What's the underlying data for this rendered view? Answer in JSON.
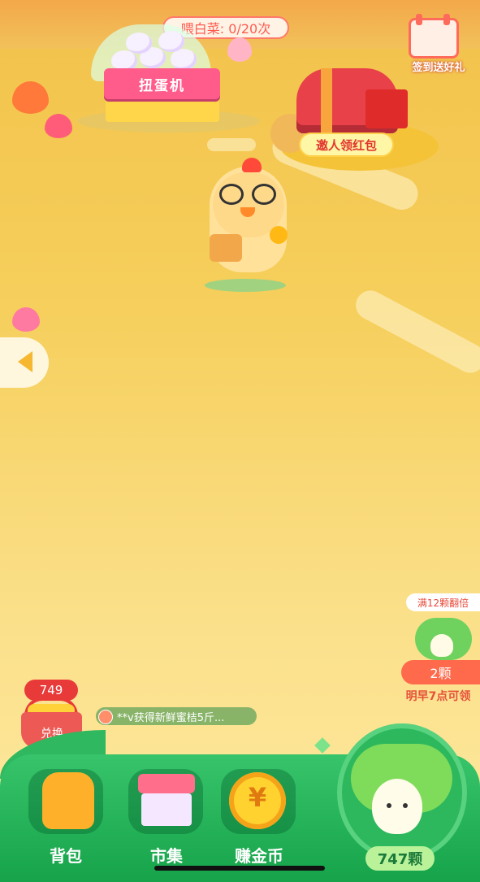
{
  "feed": {
    "label": "喂白菜: 0/20次"
  },
  "gacha": {
    "sign": "扭蛋机"
  },
  "signin": {
    "label": "签到送好礼"
  },
  "invite": {
    "label": "邀人领红包"
  },
  "reward": {
    "double_tip": "满12颗翻倍",
    "amount": "2颗",
    "claim_time": "明早7点可领"
  },
  "basket": {
    "count": "749",
    "label": "兑换"
  },
  "ticker": {
    "message": "**v获得新鲜蜜桔5斤..."
  },
  "nav": {
    "backpack": "背包",
    "market": "市集",
    "earn_coins": "赚金币"
  },
  "cabbage": {
    "count": "747颗"
  },
  "colors": {
    "accent": "#ff5a4f",
    "green": "#16a34a",
    "ground": "#f6cf5c"
  }
}
